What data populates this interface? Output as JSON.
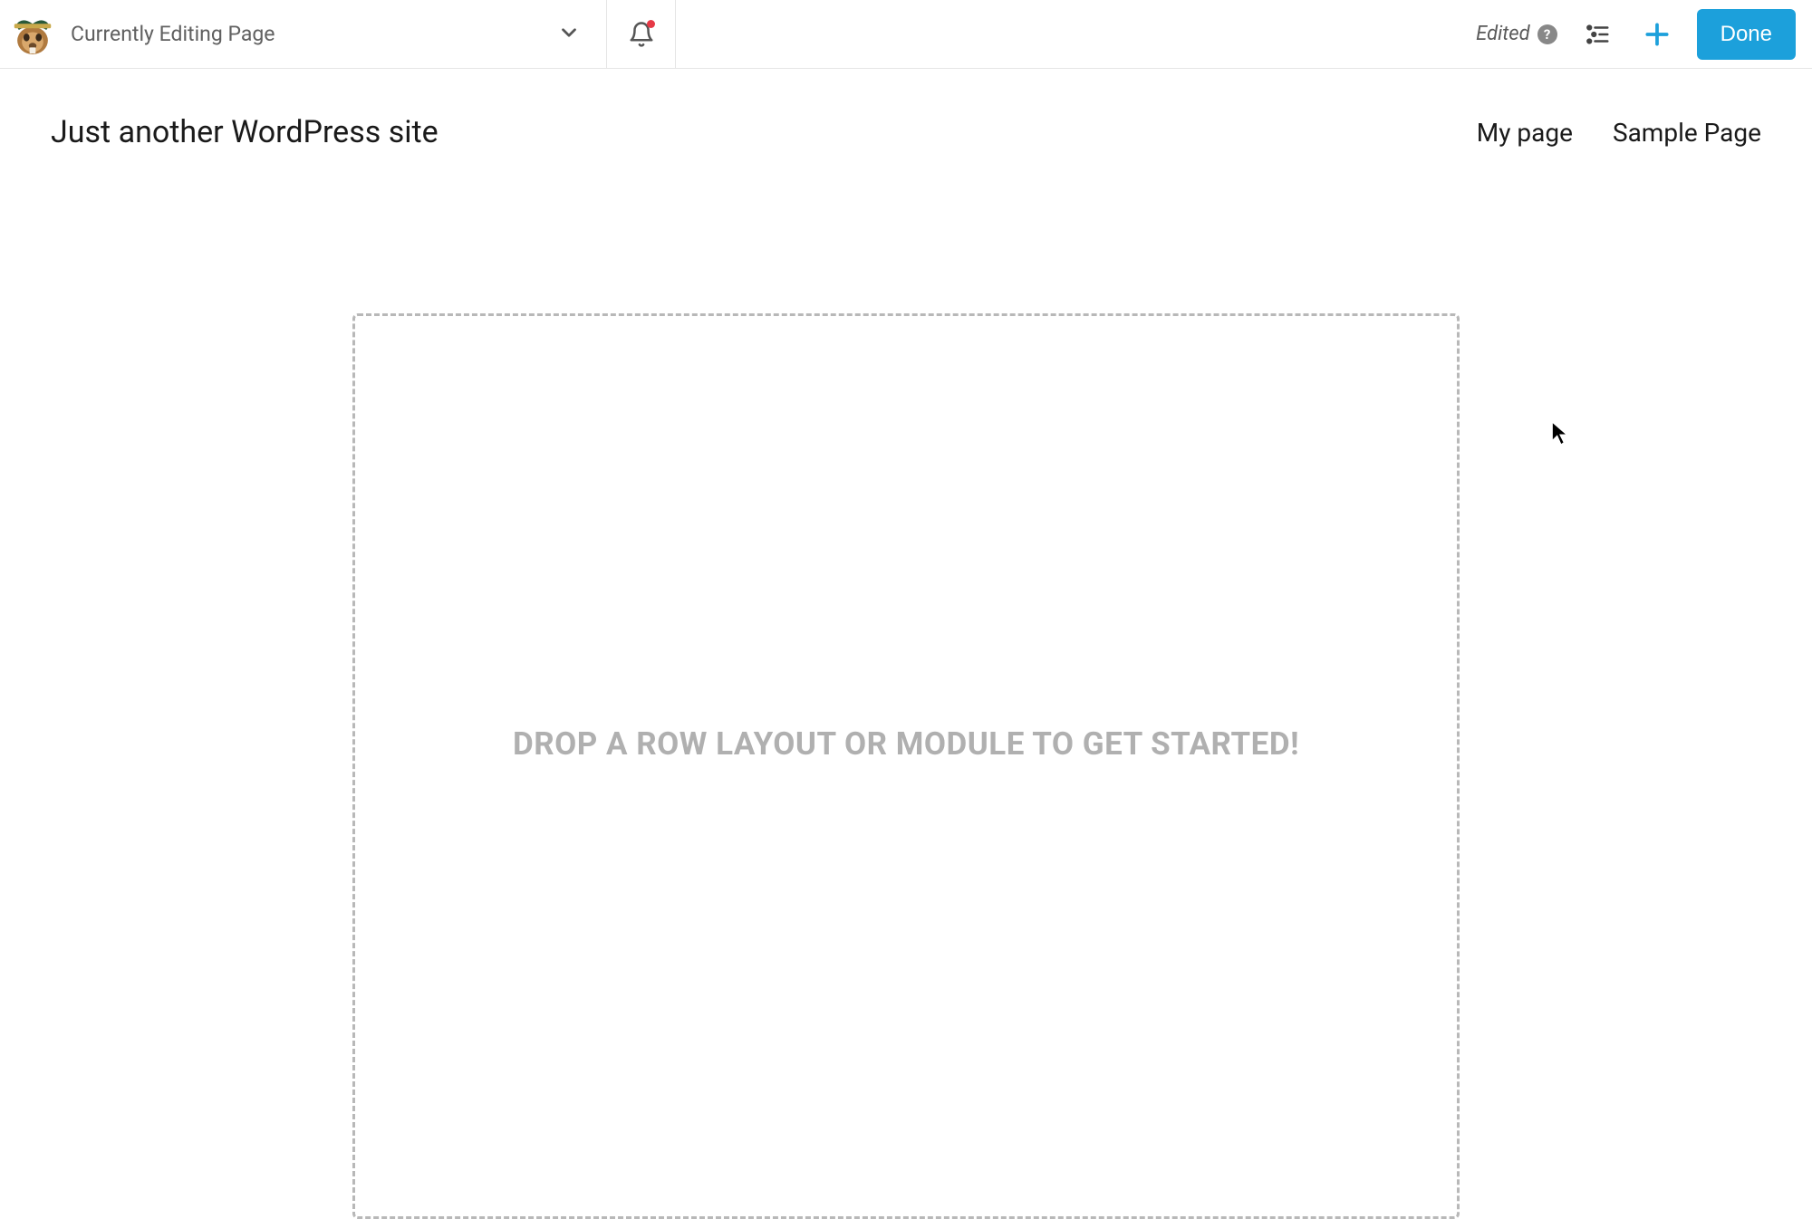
{
  "toolbar": {
    "editing_label": "Currently Editing Page",
    "edited_label": "Edited",
    "done_label": "Done"
  },
  "site": {
    "title": "Just another WordPress site",
    "nav": [
      {
        "label": "My page"
      },
      {
        "label": "Sample Page"
      }
    ]
  },
  "canvas": {
    "drop_hint": "DROP A ROW LAYOUT OR MODULE TO GET STARTED!"
  }
}
